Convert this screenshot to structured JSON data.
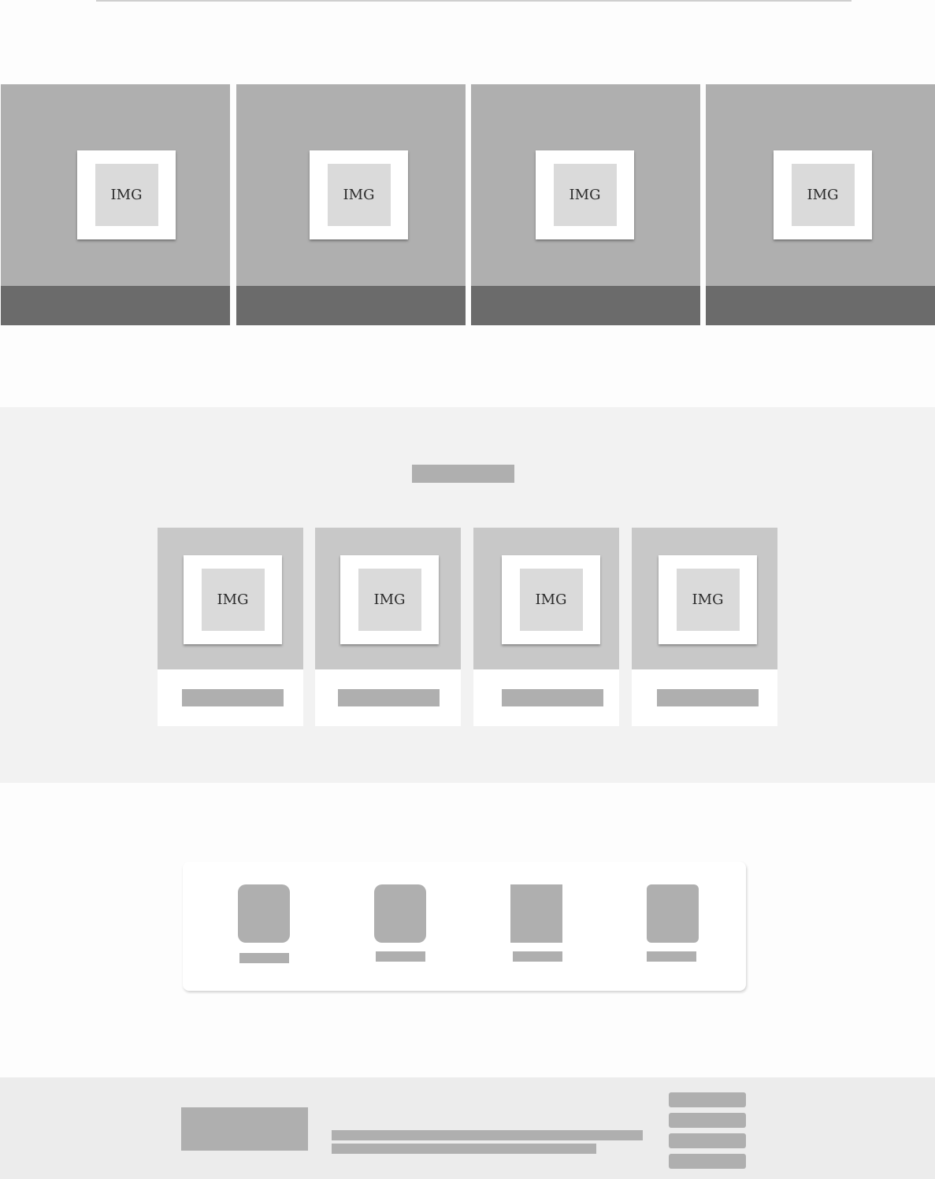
{
  "hero": {
    "tiles": [
      {
        "image_label": "IMG"
      },
      {
        "image_label": "IMG"
      },
      {
        "image_label": "IMG"
      },
      {
        "image_label": "IMG"
      }
    ]
  },
  "featured": {
    "cards": [
      {
        "image_label": "IMG"
      },
      {
        "image_label": "IMG"
      },
      {
        "image_label": "IMG"
      },
      {
        "image_label": "IMG"
      }
    ]
  }
}
